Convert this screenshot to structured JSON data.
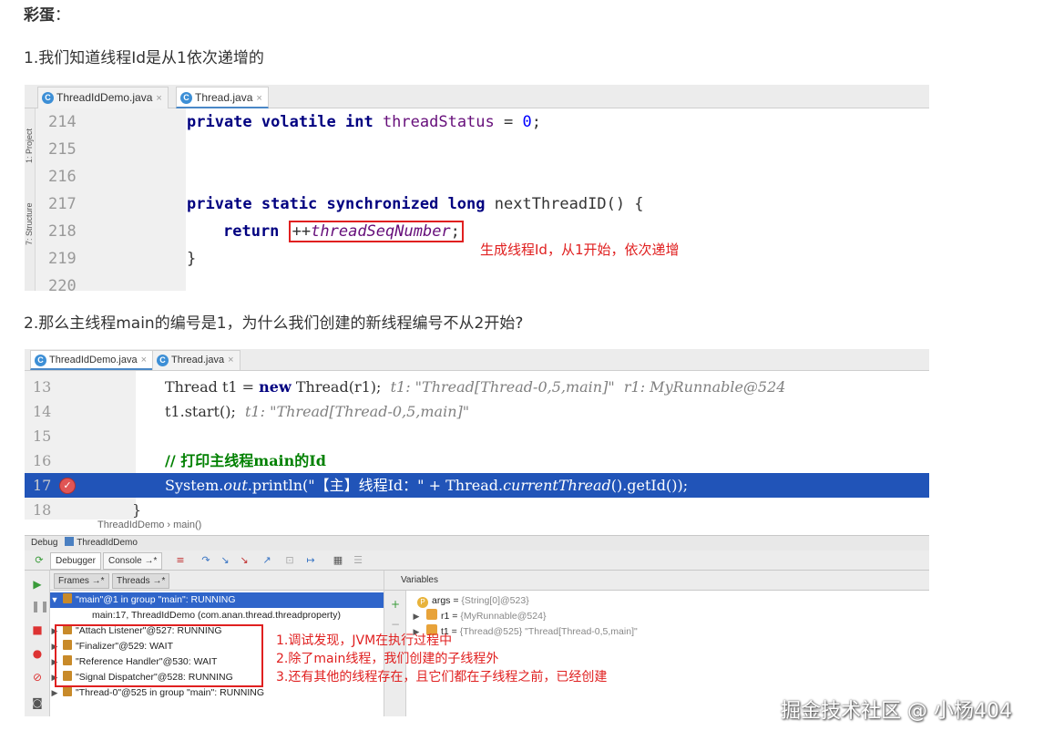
{
  "headings": {
    "easter_egg_label": "彩蛋",
    "easter_egg_colon": "：",
    "point1": "1.我们知道线程Id是从1依次递增的",
    "point2": "2.那么主线程main的编号是1，为什么我们创建的新线程编号不从2开始?"
  },
  "shot1": {
    "tabs": [
      {
        "label": "ThreadIdDemo.java",
        "close": "×"
      },
      {
        "label": "Thread.java",
        "close": "×"
      }
    ],
    "side_labels": [
      "1: Project",
      "7: Structure"
    ],
    "lines": [
      {
        "num": "214"
      },
      {
        "num": "215"
      },
      {
        "num": "216"
      },
      {
        "num": "217"
      },
      {
        "num": "218"
      },
      {
        "num": "219"
      },
      {
        "num": "220"
      }
    ],
    "code": {
      "l214_kw": "private volatile int ",
      "l214_field": "threadStatus",
      "l214_rest": " = ",
      "l214_num": "0",
      "l214_end": ";",
      "l217_kw": "private static synchronized long ",
      "l217_rest": "nextThreadID() {",
      "l218_kw": "return ",
      "l218_op": "++",
      "l218_field": "threadSeqNumber",
      "l218_end": ";",
      "l219": "}"
    },
    "annotation": "生成线程Id，从1开始，依次递增"
  },
  "shot2": {
    "tabs": [
      {
        "label": "ThreadIdDemo.java",
        "close": "×"
      },
      {
        "label": "Thread.java",
        "close": "×"
      }
    ],
    "lines": [
      {
        "num": "13"
      },
      {
        "num": "14"
      },
      {
        "num": "15"
      },
      {
        "num": "16"
      },
      {
        "num": "17"
      },
      {
        "num": "18"
      }
    ],
    "code": {
      "l13_a": "Thread t1 = ",
      "l13_kw": "new",
      "l13_b": " Thread(r1);",
      "l13_cmt": "  t1: \"Thread[Thread-0,5,main]\"  r1: MyRunnable@524",
      "l14_a": "t1.start();",
      "l14_cmt": "  t1: \"Thread[Thread-0,5,main]\"",
      "l16_cmt": "// 打印主线程main的Id",
      "l17_a": "System.",
      "l17_out": "out",
      "l17_b": ".println(\"【主】线程Id：\" + Thread.",
      "l17_cur": "currentThread",
      "l17_c": "().getId());",
      "l18": "}"
    },
    "breadcrumb": "ThreadIdDemo  ›  main()",
    "debug_bar": {
      "label": "Debug",
      "config": "ThreadIdDemo"
    },
    "toolbar_tabs": {
      "debugger": "Debugger",
      "console": "Console →*"
    },
    "subtabs": {
      "frames": "Frames →*",
      "threads": "Threads →*"
    },
    "threads": [
      {
        "text": "\"main\"@1 in group \"main\": RUNNING"
      },
      {
        "text": "main:17, ThreadIdDemo (com.anan.thread.threadproperty)"
      },
      {
        "text": "\"Attach Listener\"@527: RUNNING"
      },
      {
        "text": "\"Finalizer\"@529: WAIT"
      },
      {
        "text": "\"Reference Handler\"@530: WAIT"
      },
      {
        "text": "\"Signal Dispatcher\"@528: RUNNING"
      },
      {
        "text": "\"Thread-0\"@525 in group \"main\": RUNNING"
      }
    ],
    "annotations": [
      "1.调试发现，JVM在执行过程中",
      "2.除了main线程，我们创建的子线程外",
      "3.还有其他的线程存在，且它们都在子线程之前，已经创建"
    ],
    "variables_header": "Variables",
    "variables": [
      {
        "badge": "P",
        "name": "args",
        "eq": " = ",
        "value": "{String[0]@523}"
      },
      {
        "badge": "",
        "name": "r1",
        "eq": " = ",
        "value": "{MyRunnable@524}"
      },
      {
        "badge": "",
        "name": "t1",
        "eq": " = ",
        "value": "{Thread@525} \"Thread[Thread-0,5,main]\""
      }
    ]
  },
  "watermark": "掘金技术社区 @ 小杨404",
  "colors": {
    "annotation_red": "#e02020",
    "selection_blue": "#2154b8",
    "keyword": "#000080",
    "field": "#660e7a"
  }
}
